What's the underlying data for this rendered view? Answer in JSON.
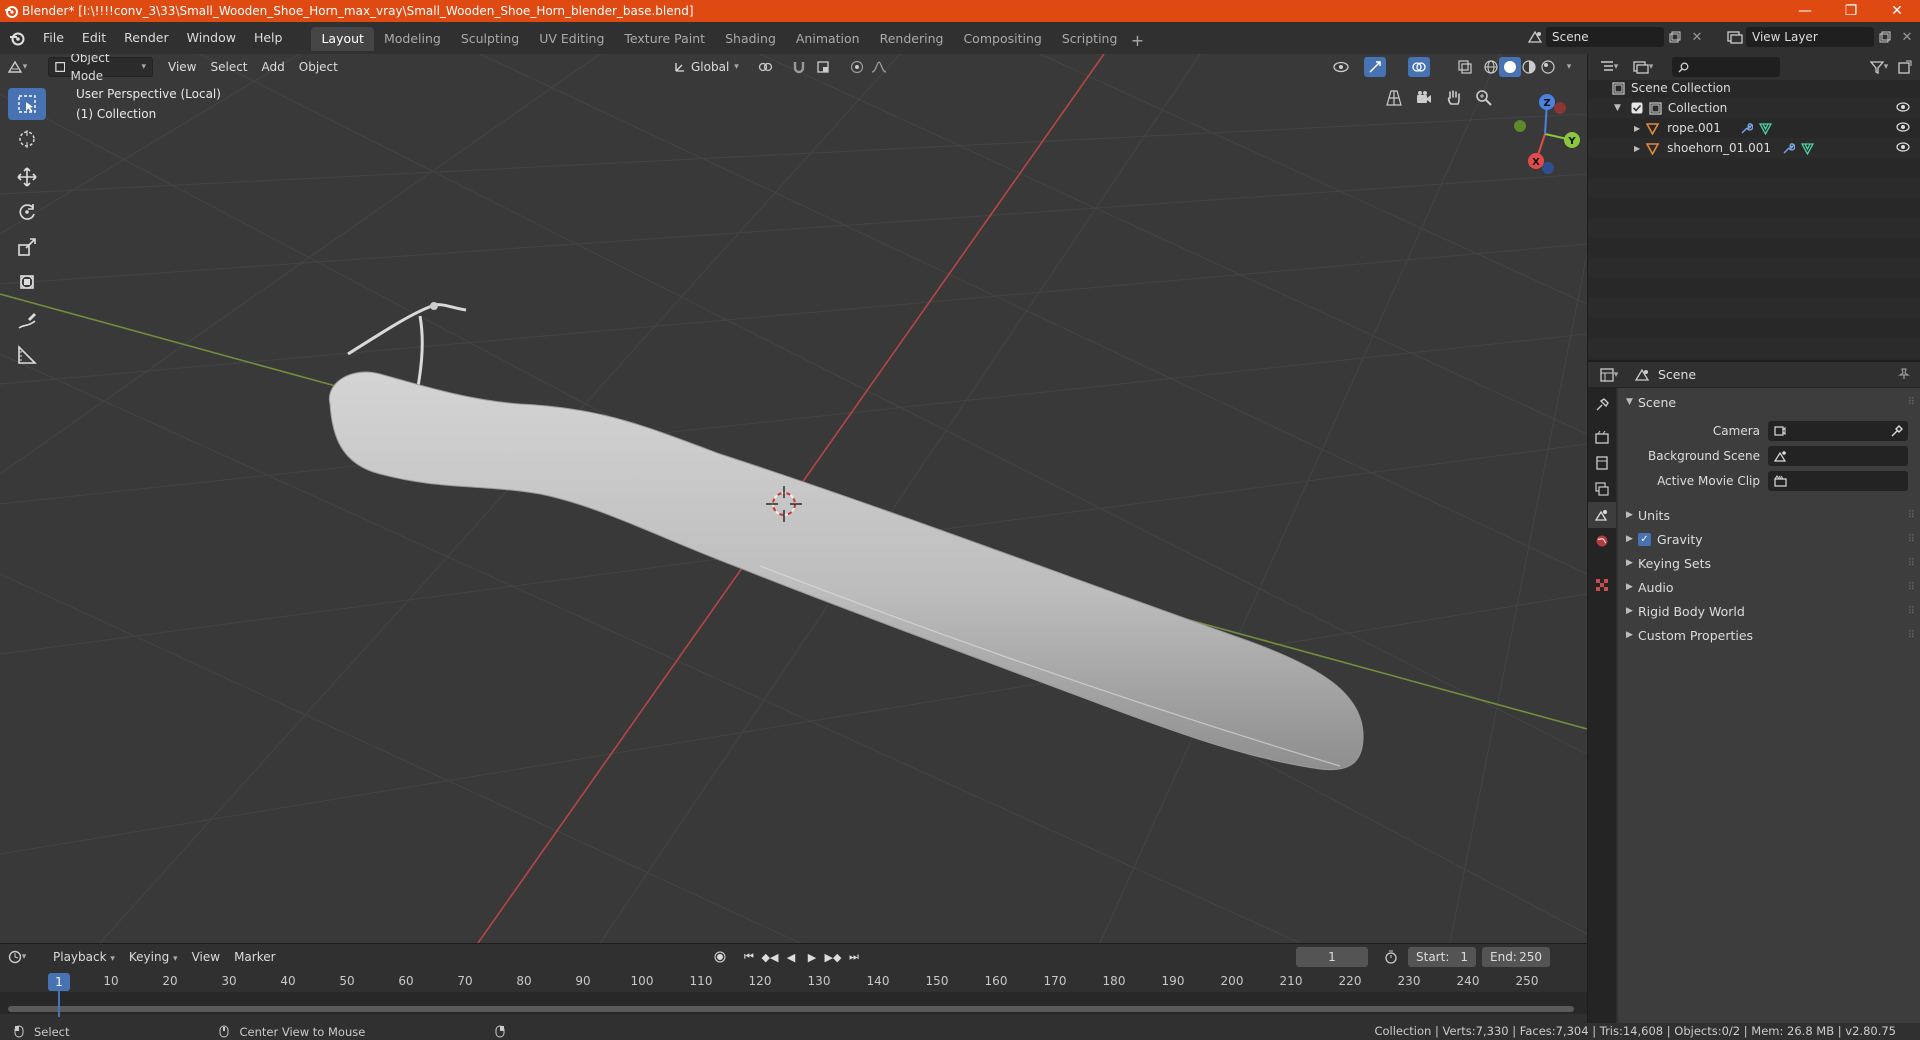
{
  "window": {
    "title": "Blender* [I:\\!!!!conv_3\\33\\Small_Wooden_Shoe_Horn_max_vray\\Small_Wooden_Shoe_Horn_blender_base.blend]",
    "minimize": "—",
    "maximize": "❐",
    "close": "✕"
  },
  "menu": {
    "items": [
      "File",
      "Edit",
      "Render",
      "Window",
      "Help"
    ]
  },
  "workspaces": {
    "tabs": [
      "Layout",
      "Modeling",
      "Sculpting",
      "UV Editing",
      "Texture Paint",
      "Shading",
      "Animation",
      "Rendering",
      "Compositing",
      "Scripting"
    ],
    "active": "Layout",
    "add": "+"
  },
  "scene_selector": {
    "value": "Scene"
  },
  "view_layer_selector": {
    "value": "View Layer"
  },
  "viewport": {
    "mode": "Object Mode",
    "menus": [
      "View",
      "Select",
      "Add",
      "Object"
    ],
    "transform_orientation": "Global",
    "info_line1": "User Perspective (Local)",
    "info_line2": "(1) Collection",
    "gizmo_axes": {
      "x": "X",
      "y": "Y",
      "z": "Z"
    }
  },
  "outliner": {
    "search_placeholder": "",
    "root": "Scene Collection",
    "collection": "Collection",
    "objects": [
      "rope.001",
      "shoehorn_01.001"
    ]
  },
  "properties": {
    "context": "Scene",
    "panels": {
      "scene": "Scene",
      "camera_label": "Camera",
      "background_scene_label": "Background Scene",
      "active_movie_clip_label": "Active Movie Clip",
      "units": "Units",
      "gravity": "Gravity",
      "keying_sets": "Keying Sets",
      "audio": "Audio",
      "rigid_body_world": "Rigid Body World",
      "custom_properties": "Custom Properties"
    }
  },
  "timeline": {
    "menus": [
      "Playback",
      "Keying",
      "View",
      "Marker"
    ],
    "current_frame": "1",
    "start_label": "Start:",
    "start": "1",
    "end_label": "End:",
    "end": "250",
    "ruler": [
      "1",
      "10",
      "20",
      "30",
      "40",
      "50",
      "60",
      "70",
      "80",
      "90",
      "100",
      "110",
      "120",
      "130",
      "140",
      "150",
      "160",
      "170",
      "180",
      "190",
      "200",
      "210",
      "220",
      "230",
      "240",
      "250"
    ]
  },
  "statusbar": {
    "left_action": "Select",
    "middle_action": "Center View to Mouse",
    "stats": "Collection | Verts:7,330 | Faces:7,304 | Tris:14,608 | Objects:0/2 | Mem: 26.8 MB | v2.80.75"
  },
  "colors": {
    "titlebar": "#de4a12",
    "accent": "#4772b3",
    "viewport_bg": "#393939",
    "axis_x": "#d23b3b",
    "axis_y": "#7ab33e"
  }
}
